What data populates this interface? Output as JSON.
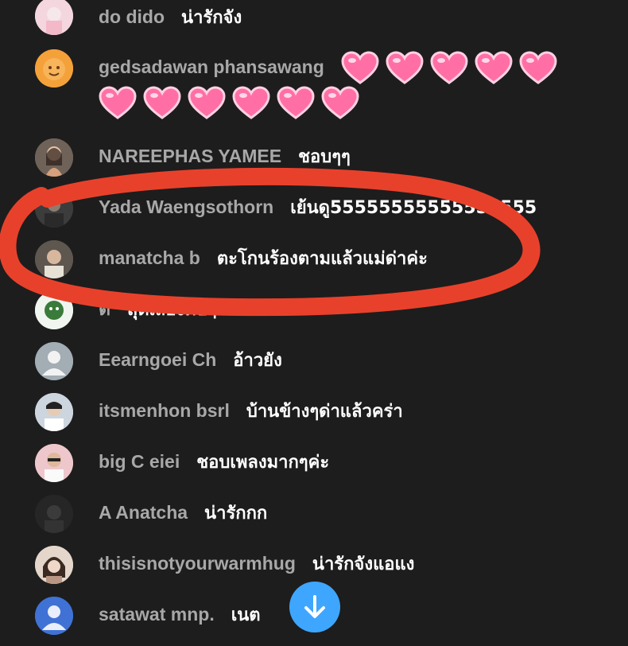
{
  "messages": [
    {
      "author": "do dido",
      "text": "น่ารักจัง",
      "avatar": "#f2c9d4"
    },
    {
      "author": "gedsadawan phansawang",
      "text": "",
      "hearts": 11,
      "avatar": "#f5a13a"
    },
    {
      "author": "NAREEPHAS YAMEE",
      "text": "ชอบๆๆ",
      "avatar": "#8a7566"
    },
    {
      "author": "Yada Waengsothorn",
      "text": "เย้นดู55555555555555555",
      "avatar": "#4a4a4a"
    },
    {
      "author": "manatcha b",
      "text": "ตะโกนร้องตามแล้วแม่ด่าค่ะ",
      "avatar": "#6d655d"
    },
    {
      "author": "ต่",
      "text": "สุดเสียงคับๆ",
      "avatar": "#e8efe6"
    },
    {
      "author": "Eearngoei Ch",
      "text": "อ้าวยัง",
      "avatar": "#9aa6ae"
    },
    {
      "author": "itsmenhon bsrl",
      "text": "บ้านข้างๆด่าแล้วคร่า",
      "avatar": "#c9d3dd"
    },
    {
      "author": "big C eiei",
      "text": "ชอบเพลงมากๆค่ะ",
      "avatar": "#e9c2c7"
    },
    {
      "author": "A Anatcha",
      "text": "น่ารักกก",
      "avatar": "#2a2a2a"
    },
    {
      "author": "thisisnotyourwarmhug",
      "text": "น่ารักจังแอแง",
      "avatar": "#d9c7b8"
    },
    {
      "author": "satawat mnp.",
      "text": "เนต",
      "avatar": "#3b6fd1"
    }
  ],
  "scroll_button": {
    "icon": "arrow-down-icon",
    "color": "#3ea6ff"
  },
  "annotation": {
    "type": "hand-drawn-circle",
    "color": "#e8412b"
  },
  "colors": {
    "background": "#1d1d1d",
    "author": "#a8a8a8",
    "text": "#ffffff"
  }
}
